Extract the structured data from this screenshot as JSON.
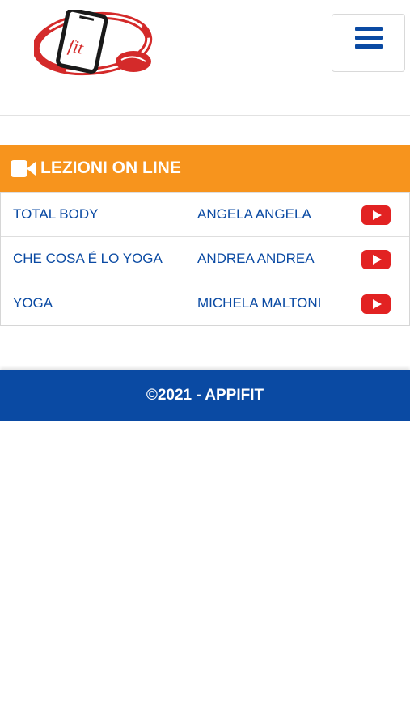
{
  "header": {
    "logo_text": "fit",
    "menu_icon": "hamburger-icon"
  },
  "panel": {
    "heading": "LEZIONI ON LINE",
    "heading_icon": "video-camera-icon",
    "accent_color": "#f7941d",
    "rows": [
      {
        "title": "TOTAL BODY",
        "trainer": "ANGELA ANGELA",
        "icon": "youtube-play-icon"
      },
      {
        "title": "CHE COSA É LO YOGA",
        "trainer": "ANDREA ANDREA",
        "icon": "youtube-play-icon"
      },
      {
        "title": "YOGA",
        "trainer": "MICHELA MALTONI",
        "icon": "youtube-play-icon"
      }
    ]
  },
  "footer": {
    "text": "©2021 - APPIFIT",
    "color": "#0a4aa3"
  }
}
